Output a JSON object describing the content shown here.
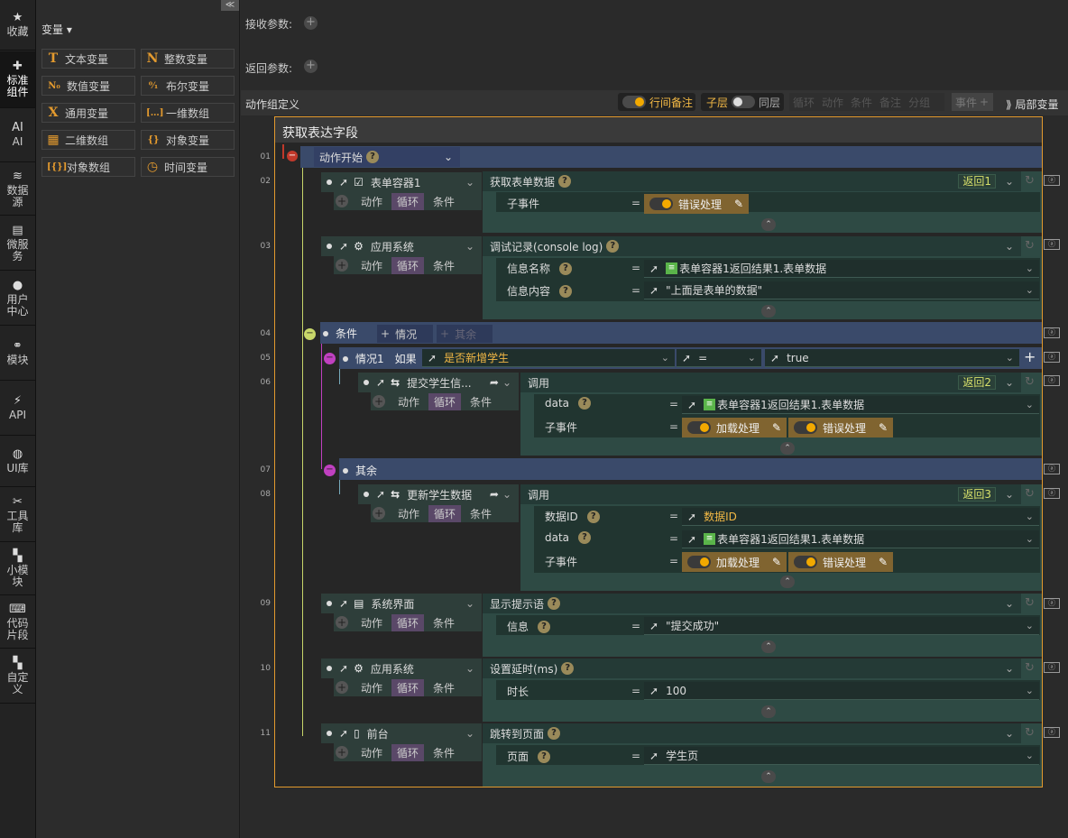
{
  "nav": {
    "items": [
      {
        "label": "收藏",
        "icon": "star-icon"
      },
      {
        "label": "标准组件",
        "icon": "puzzle-icon"
      },
      {
        "label": "AI",
        "icon": "ai-icon"
      },
      {
        "label": "数据源",
        "icon": "database-icon"
      },
      {
        "label": "微服务",
        "icon": "microservice-icon"
      },
      {
        "label": "用户中心",
        "icon": "user-icon"
      },
      {
        "label": "模块",
        "icon": "module-icon"
      },
      {
        "label": "API",
        "icon": "plug-icon"
      },
      {
        "label": "UI库",
        "icon": "ui-icon"
      },
      {
        "label": "工具库",
        "icon": "tools-icon"
      },
      {
        "label": "小模块",
        "icon": "small-module-icon"
      },
      {
        "label": "代码片段",
        "icon": "code-icon"
      },
      {
        "label": "自定义",
        "icon": "custom-icon"
      }
    ]
  },
  "library": {
    "collapse": "≪",
    "section": "变量",
    "vars": [
      {
        "icon": "T",
        "label": "文本变量"
      },
      {
        "icon": "N",
        "label": "整数变量"
      },
      {
        "icon": "N₀",
        "label": "数值变量"
      },
      {
        "icon": "⁰⁄₁",
        "label": "布尔变量"
      },
      {
        "icon": "X",
        "label": "通用变量"
      },
      {
        "icon": "[…]",
        "label": "一维数组"
      },
      {
        "icon": "▦",
        "label": "二维数组"
      },
      {
        "icon": "{}",
        "label": "对象变量"
      },
      {
        "icon": "[{}]",
        "label": "对象数组"
      },
      {
        "icon": "◷",
        "label": "时间变量"
      }
    ]
  },
  "params": {
    "receive": "接收参数:",
    "return": "返回参数:"
  },
  "toolbar": {
    "title": "动作组定义",
    "inline_note": "行间备注",
    "child_layer": "子层",
    "same_layer": "同层",
    "loop": "循环",
    "action": "动作",
    "condition": "条件",
    "note": "备注",
    "group": "分组",
    "event": "事件",
    "local_var": "局部变量"
  },
  "group": {
    "title": "获取表达字段",
    "start": "动作开始",
    "common": {
      "action": "动作",
      "loop": "循环",
      "cond": "条件",
      "sub_event": "子事件",
      "call": "调用",
      "else": "其余",
      "case_if": "如果"
    },
    "nodes": {
      "n02": {
        "ln": "02",
        "title": "表单容器1",
        "method": "获取表单数据",
        "ret": "返回1",
        "pill": "错误处理"
      },
      "n03": {
        "ln": "03",
        "title": "应用系统",
        "method": "调试记录(console log)",
        "f1": "信息名称",
        "v1": "表单容器1返回结果1.表单数据",
        "f2": "信息内容",
        "v2": "\"上面是表单的数据\""
      },
      "n04": {
        "ln": "04",
        "title": "条件",
        "case": "情况",
        "else": "其余"
      },
      "n05": {
        "ln": "05",
        "label": "情况1",
        "var": "是否新增学生",
        "op": "=",
        "val": "true"
      },
      "n06": {
        "ln": "06",
        "title": "提交学生信...",
        "ret": "返回2",
        "f1": "data",
        "v1": "表单容器1返回结果1.表单数据",
        "p1": "加载处理",
        "p2": "错误处理"
      },
      "n07": {
        "ln": "07"
      },
      "n08": {
        "ln": "08",
        "title": "更新学生数据",
        "ret": "返回3",
        "f0": "数据ID",
        "v0": "数据ID",
        "f1": "data",
        "v1": "表单容器1返回结果1.表单数据",
        "p1": "加载处理",
        "p2": "错误处理"
      },
      "n09": {
        "ln": "09",
        "title": "系统界面",
        "method": "显示提示语",
        "f1": "信息",
        "v1": "\"提交成功\""
      },
      "n10": {
        "ln": "10",
        "title": "应用系统",
        "method": "设置延时(ms)",
        "f1": "时长",
        "v1": "100"
      },
      "n11": {
        "ln": "11",
        "title": "前台",
        "method": "跳转到页面",
        "f1": "页面",
        "v1": "学生页"
      },
      "ln01": "01"
    }
  },
  "colors": {
    "accent": "#e39a2e",
    "panel_green": "#2e4a44",
    "band_blue": "#3a4a6a",
    "case_magenta": "#c040c0"
  }
}
